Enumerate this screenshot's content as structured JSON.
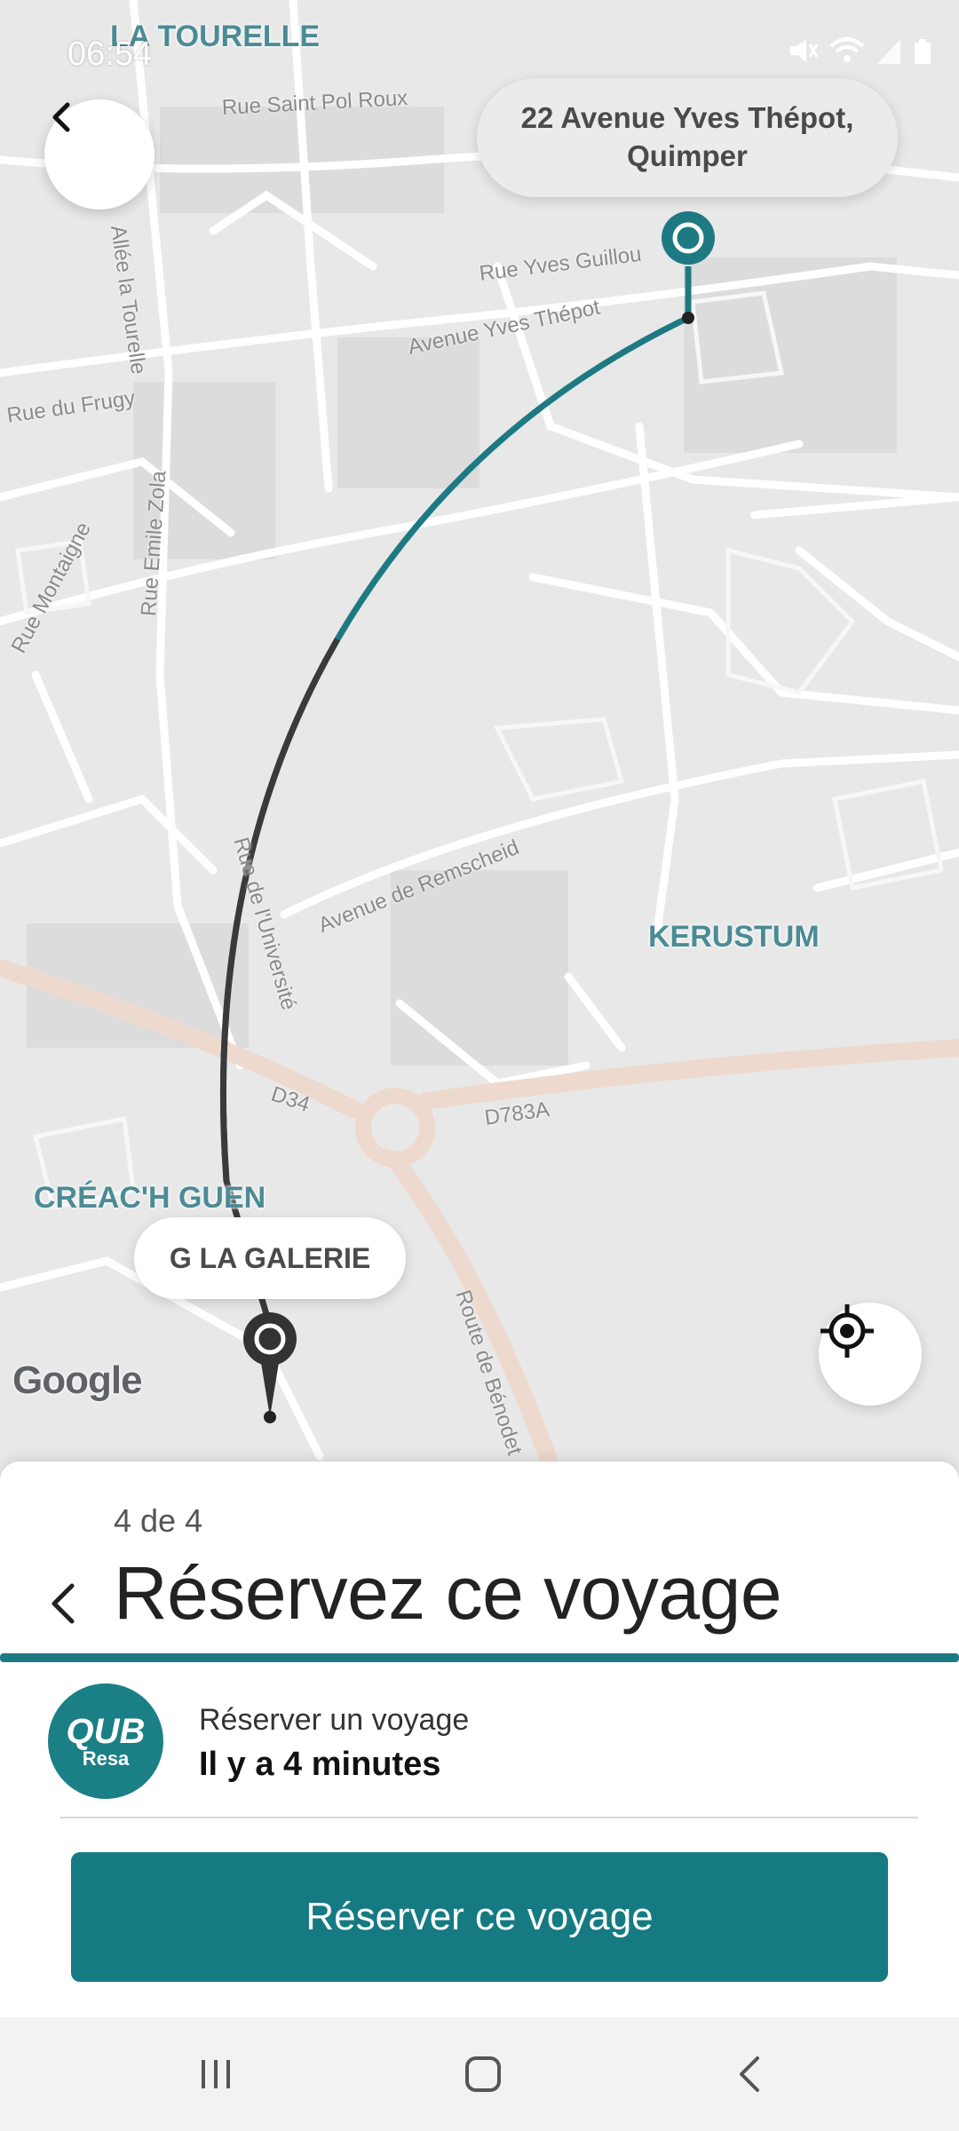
{
  "status_bar": {
    "time": "06:54"
  },
  "map": {
    "destination": {
      "label": "22 Avenue Yves Thépot,\nQuimper"
    },
    "origin": {
      "label": "G LA GALERIE"
    },
    "place_labels": [
      "LA TOURELLE",
      "KERUSTUM",
      "CRÉAC'H GUEN"
    ],
    "street_labels": [
      "Rue Saint Pol Roux",
      "Rue Yves Guillou",
      "Avenue Yves Thépot",
      "Rue du Frugy",
      "Rue Emile Zola",
      "Rue Montaigne",
      "Avenue de Remscheid",
      "Rue de l'Université",
      "D34",
      "D783A",
      "Route de Bénodet",
      "Allée la Tourelle"
    ],
    "attribution": "Google",
    "route_color": "#1e7a82"
  },
  "sheet": {
    "step": "4 de 4",
    "title": "Réservez ce voyage",
    "event_label": "Réserver un voyage",
    "event_time": "Il y a 4 minutes",
    "logo_main": "QUB",
    "logo_sub": "Resa",
    "cta_label": "Réserver ce voyage",
    "accent": "#1e7a82"
  },
  "icons": {
    "map_back": "chevron-left-icon",
    "locate": "crosshair-icon",
    "sheet_back": "chevron-left-icon",
    "nav_recents": "recents-icon",
    "nav_home": "home-icon",
    "nav_back": "back-icon"
  }
}
